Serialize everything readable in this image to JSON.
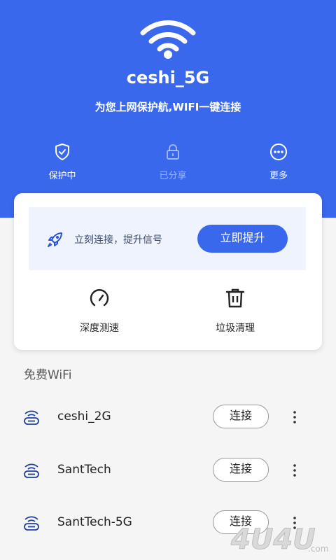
{
  "header": {
    "ssid": "ceshi_5G",
    "subtitle": "为您上网保护航,WIFI一键连接",
    "bg_color": "#3a68ec"
  },
  "actions": [
    {
      "label": "保护中",
      "icon": "shield-check-icon"
    },
    {
      "label": "已分享",
      "icon": "lock-icon"
    },
    {
      "label": "更多",
      "icon": "more-icon"
    }
  ],
  "boost": {
    "text": "立刻连接，提升信号",
    "button": "立即提升",
    "icon": "rocket-icon"
  },
  "tools": [
    {
      "label": "深度测速",
      "icon": "speedometer-icon"
    },
    {
      "label": "垃圾清理",
      "icon": "trash-icon"
    }
  ],
  "free_wifi": {
    "title": "免费WiFi",
    "connect_label": "连接",
    "networks": [
      {
        "name": "ceshi_2G"
      },
      {
        "name": "SantTech"
      },
      {
        "name": "SantTech-5G"
      }
    ]
  },
  "watermark": {
    "text": "4U4U.com"
  }
}
